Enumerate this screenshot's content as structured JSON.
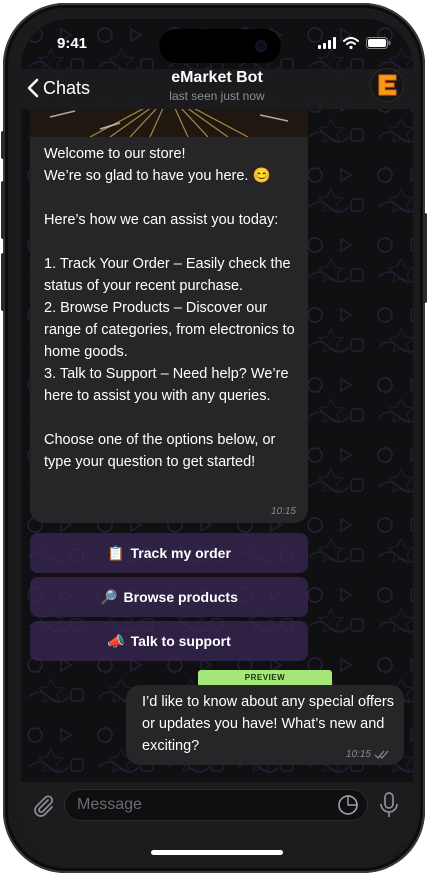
{
  "status_bar": {
    "time": "9:41"
  },
  "header": {
    "back_label": "Chats",
    "title": "eMarket Bot",
    "subtitle": "last seen just now",
    "avatar_letter": "E",
    "accent_color": "#f39c12"
  },
  "message": {
    "paragraphs": [
      "Welcome to our store!",
      "We’re so glad to have you here. 😊",
      "",
      "Here’s how we can assist you today:",
      "",
      "1. Track Your Order – Easily check the status of your recent purchase.",
      "2. Browse Products – Discover our range of categories, from electronics to home goods.",
      "3. Talk to Support – Need help? We’re here to assist you with any queries.",
      "",
      "Choose one of the options below, or type your question to get started!"
    ],
    "time": "10:15"
  },
  "keyboard_buttons": [
    {
      "icon": "📋",
      "label": "Track my order"
    },
    {
      "icon": "🔎",
      "label": "Browse products"
    },
    {
      "icon": "📣",
      "label": "Talk to support"
    }
  ],
  "outgoing": {
    "tag": "PREVIEW",
    "text": "I’d like to know about any special offers or updates you have! What’s new and exciting?",
    "time": "10:15"
  },
  "input": {
    "placeholder": "Message"
  },
  "icons": {
    "attach": "paperclip-icon",
    "sticker": "sticker-icon",
    "mic": "microphone-icon",
    "read": "double-check-icon"
  }
}
